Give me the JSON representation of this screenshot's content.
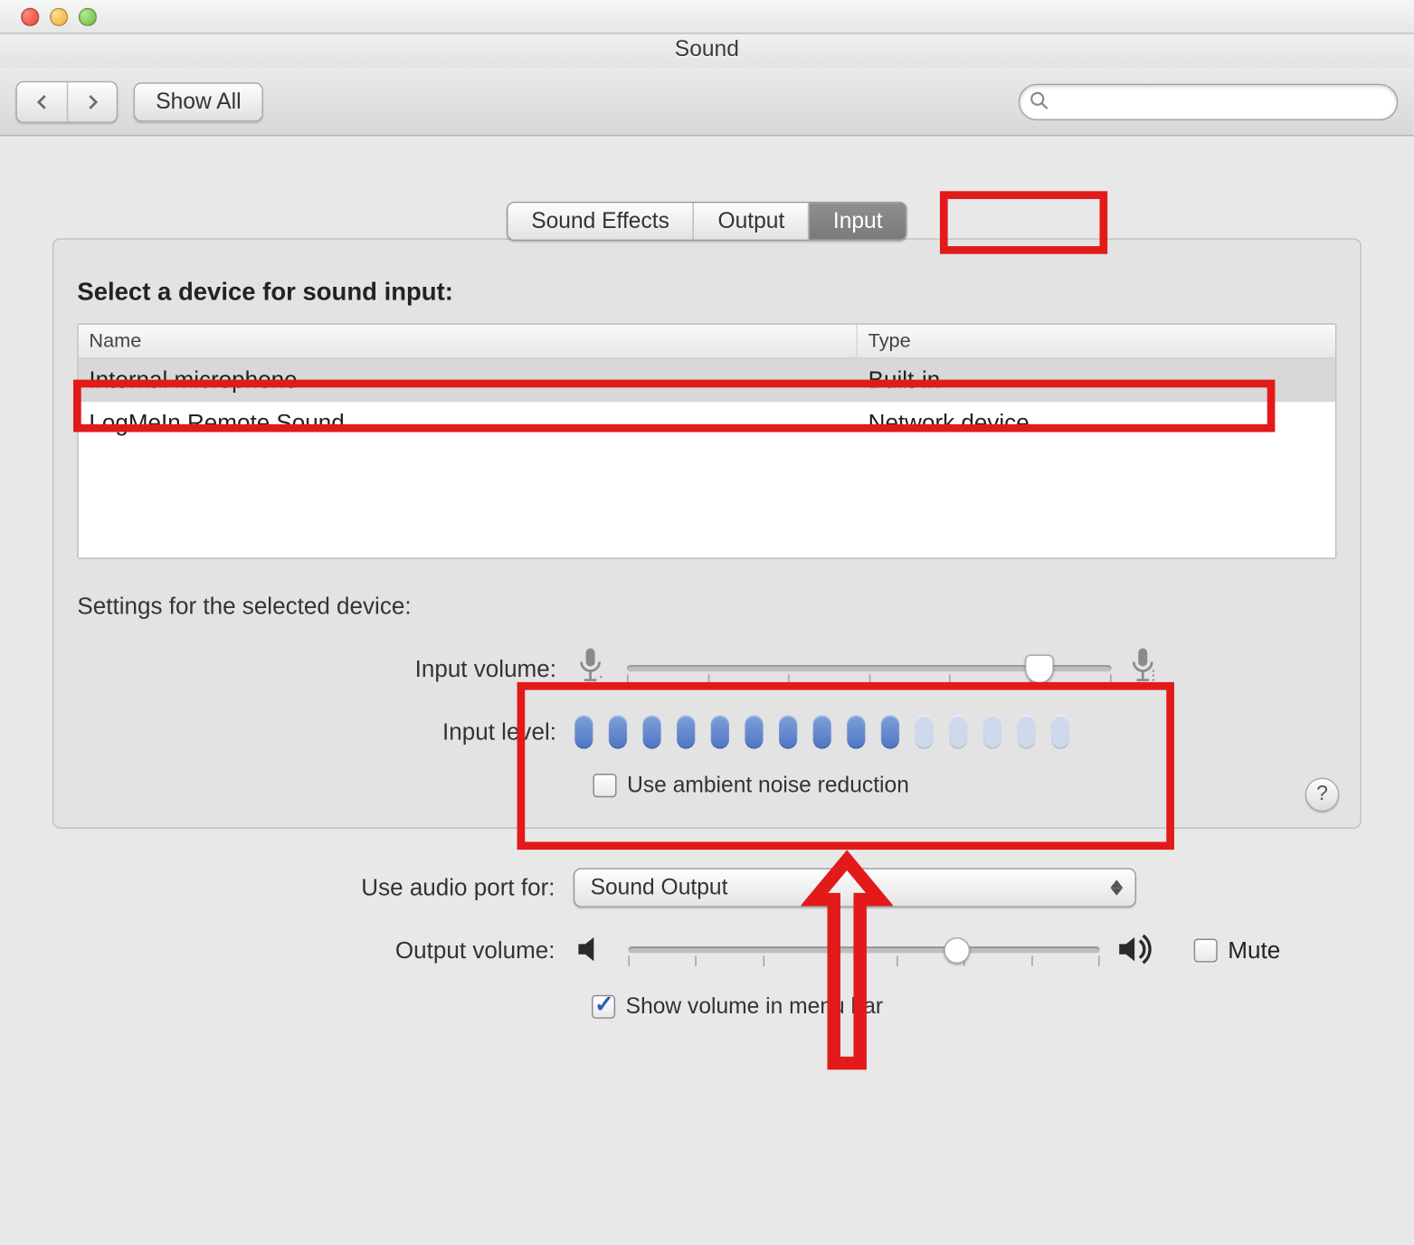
{
  "window": {
    "title": "Sound"
  },
  "toolbar": {
    "show_all_label": "Show All",
    "search_placeholder": ""
  },
  "tabs": {
    "sound_effects": "Sound Effects",
    "output": "Output",
    "input": "Input",
    "selected": "input"
  },
  "section": {
    "select_device_heading": "Select a device for sound input:",
    "columns": {
      "name": "Name",
      "type": "Type"
    },
    "devices": [
      {
        "name": "Internal microphone",
        "type": "Built-in",
        "selected": true
      },
      {
        "name": "LogMeIn Remote Sound",
        "type": "Network device",
        "selected": false
      }
    ],
    "settings_heading": "Settings for the selected device:"
  },
  "input_volume": {
    "label": "Input volume:",
    "value_percent": 85
  },
  "input_level": {
    "label": "Input level:",
    "active_segments": 10,
    "total_segments": 15
  },
  "ambient_noise": {
    "label": "Use ambient noise reduction",
    "checked": false
  },
  "audio_port": {
    "label": "Use audio port for:",
    "value": "Sound Output"
  },
  "output_volume": {
    "label": "Output volume:",
    "value_percent": 70,
    "mute_label": "Mute",
    "mute_checked": false
  },
  "menubar": {
    "label": "Show volume in menu bar",
    "checked": true
  }
}
